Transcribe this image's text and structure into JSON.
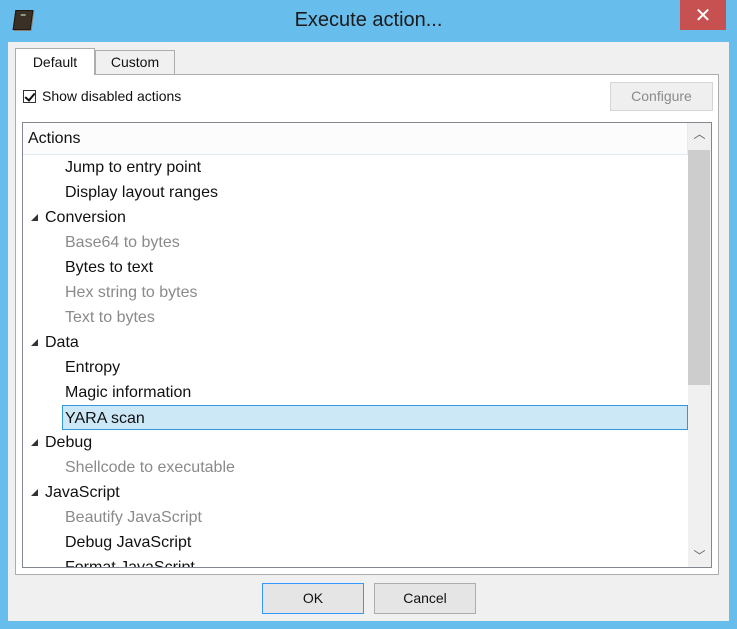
{
  "window": {
    "title": "Execute action...",
    "close_glyph": "✕",
    "app_icon": "book-icon"
  },
  "tabs": [
    {
      "label": "Default",
      "selected": true
    },
    {
      "label": "Custom",
      "selected": false
    }
  ],
  "options": {
    "show_disabled_label": "Show disabled actions",
    "show_disabled_checked": true,
    "configure_label": "Configure",
    "configure_enabled": false
  },
  "tree": {
    "header": "Actions",
    "rows": [
      {
        "label": "Jump to entry point",
        "type": "leaf",
        "disabled": false
      },
      {
        "label": "Display layout ranges",
        "type": "leaf",
        "disabled": false
      },
      {
        "label": "Conversion",
        "type": "group",
        "expanded": true
      },
      {
        "label": "Base64 to bytes",
        "type": "leaf",
        "disabled": true
      },
      {
        "label": "Bytes to text",
        "type": "leaf",
        "disabled": false
      },
      {
        "label": "Hex string to bytes",
        "type": "leaf",
        "disabled": true
      },
      {
        "label": "Text to bytes",
        "type": "leaf",
        "disabled": true
      },
      {
        "label": "Data",
        "type": "group",
        "expanded": true
      },
      {
        "label": "Entropy",
        "type": "leaf",
        "disabled": false
      },
      {
        "label": "Magic information",
        "type": "leaf",
        "disabled": false
      },
      {
        "label": "YARA scan",
        "type": "leaf",
        "disabled": false,
        "selected": true
      },
      {
        "label": "Debug",
        "type": "group",
        "expanded": true
      },
      {
        "label": "Shellcode to executable",
        "type": "leaf",
        "disabled": true
      },
      {
        "label": "JavaScript",
        "type": "group",
        "expanded": true
      },
      {
        "label": "Beautify JavaScript",
        "type": "leaf",
        "disabled": true
      },
      {
        "label": "Debug JavaScript",
        "type": "leaf",
        "disabled": false
      },
      {
        "label": "Format JavaScript",
        "type": "leaf",
        "disabled": false
      }
    ],
    "scroll_up_glyph": "︿",
    "scroll_down_glyph": "﹀"
  },
  "buttons": {
    "ok_label": "OK",
    "cancel_label": "Cancel"
  }
}
